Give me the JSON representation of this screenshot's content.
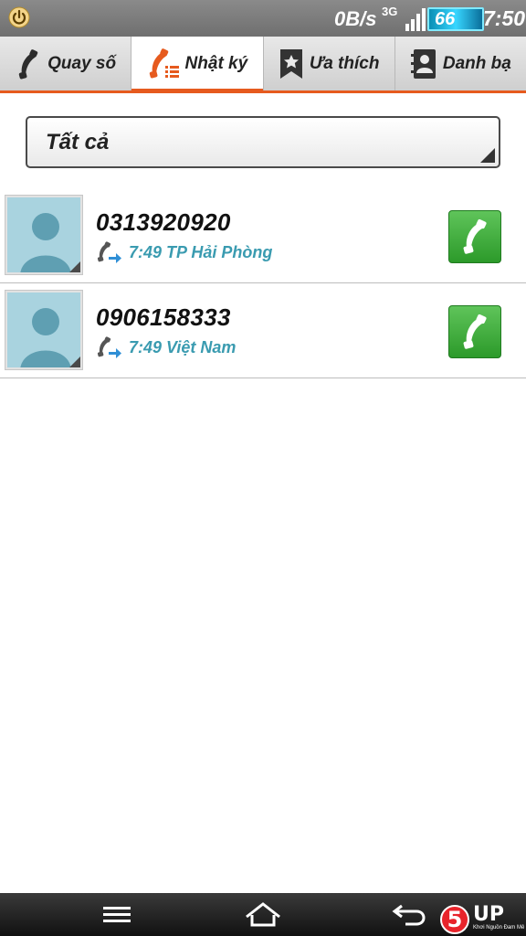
{
  "status_bar": {
    "speed": "0B/s",
    "network": "3G",
    "battery": "66",
    "time": "7:50"
  },
  "tabs": [
    {
      "label": "Quay số",
      "icon": "phone-icon",
      "active": false
    },
    {
      "label": "Nhật ký",
      "icon": "call-log-icon",
      "active": true
    },
    {
      "label": "Ưa thích",
      "icon": "favorites-icon",
      "active": false
    },
    {
      "label": "Danh bạ",
      "icon": "contacts-icon",
      "active": false
    }
  ],
  "filter": {
    "selected": "Tất cả"
  },
  "calls": [
    {
      "number": "0313920920",
      "time": "7:49",
      "location": "TP Hải Phòng",
      "type": "outgoing",
      "meta": "7:49 TP Hải Phòng"
    },
    {
      "number": "0906158333",
      "time": "7:49",
      "location": "Việt Nam",
      "type": "outgoing",
      "meta": "7:49 Việt Nam"
    }
  ],
  "watermark": {
    "logo": "5",
    "text": "UP",
    "tagline": "Khơi Nguồn Đam Mê"
  },
  "colors": {
    "accent": "#e65a1e",
    "call_button": "#3fae3c",
    "meta_text": "#3a9bb0",
    "avatar_bg": "#a9d3df"
  }
}
